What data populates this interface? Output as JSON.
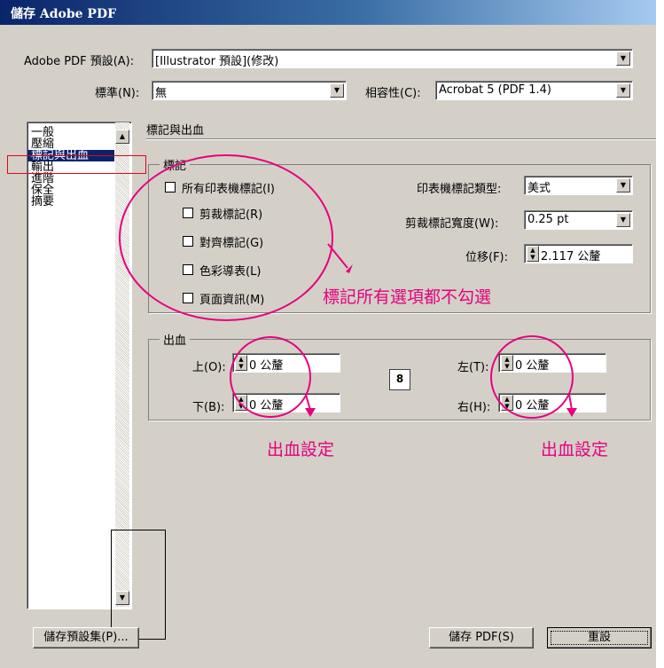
{
  "window": {
    "title": "儲存 Adobe PDF"
  },
  "preset": {
    "label": "Adobe PDF 預設(A):",
    "value": "[Illustrator 預設](修改)"
  },
  "standard": {
    "label": "標準(N):",
    "value": "無"
  },
  "compat": {
    "label": "相容性(C):",
    "value": "Acrobat 5 (PDF 1.4)"
  },
  "sidebar": {
    "items": [
      {
        "label": "一般"
      },
      {
        "label": "壓縮"
      },
      {
        "label": "標記與出血"
      },
      {
        "label": "輸出"
      },
      {
        "label": "進階"
      },
      {
        "label": "保全"
      },
      {
        "label": "摘要"
      }
    ]
  },
  "section": {
    "title": "標記與出血"
  },
  "marks": {
    "group_title": "標記",
    "all_printer_marks": "所有印表機標記(I)",
    "trim_marks": "剪裁標記(R)",
    "registration_marks": "對齊標記(G)",
    "color_bars": "色彩導表(L)",
    "page_info": "頁面資訊(M)",
    "type_label": "印表機標記類型:",
    "type_value": "美式",
    "weight_label": "剪裁標記寬度(W):",
    "weight_value": "0.25 pt",
    "offset_label": "位移(F):",
    "offset_value": "2.117 公釐"
  },
  "bleeds": {
    "group_title": "出血",
    "top_label": "上(O):",
    "top_value": "0 公釐",
    "bottom_label": "下(B):",
    "bottom_value": "0 公釐",
    "left_label": "左(T):",
    "left_value": "0 公釐",
    "right_label": "右(H):",
    "right_value": "0 公釐"
  },
  "annotations": {
    "marks_note": "標記所有選項都不勾選",
    "bleed_note_1": "出血設定",
    "bleed_note_2": "出血設定",
    "color": "#e6007e"
  },
  "buttons": {
    "save_preset": "儲存預設集(P)...",
    "save_pdf": "儲存 PDF(S)",
    "reset": "重設"
  }
}
